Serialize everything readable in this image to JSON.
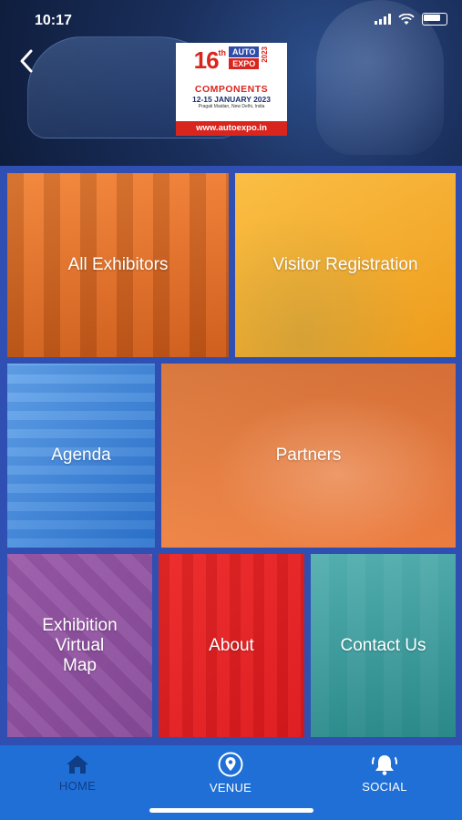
{
  "status_bar": {
    "time": "10:17"
  },
  "header": {
    "back_icon": "chevron-left-icon",
    "logo": {
      "edition_number": "16",
      "edition_suffix": "th",
      "brand_line1": "AUTO",
      "brand_line2": "EXPO",
      "year": "2023",
      "components": "COMPONENTS",
      "dates": "12-15 JANUARY 2023",
      "venue": "Pragati Maidan, New Delhi, India",
      "url": "www.autoexpo.in"
    }
  },
  "tiles": [
    {
      "label": "All Exhibitors"
    },
    {
      "label": "Visitor Registration"
    },
    {
      "label": "Agenda"
    },
    {
      "label": "Partners"
    },
    {
      "label": "Exhibition\nVirtual\nMap"
    },
    {
      "label": "About"
    },
    {
      "label": "Contact Us"
    }
  ],
  "bottom_nav": {
    "home": {
      "label": "HOME",
      "icon": "home-icon"
    },
    "venue": {
      "label": "VENUE",
      "icon": "location-pin-icon"
    },
    "social": {
      "label": "SOCIAL",
      "icon": "bell-icon"
    }
  },
  "colors": {
    "header_bg": "#1a2f5c",
    "grid_bg": "#2f4fb2",
    "nav_bg": "#1f6fd6",
    "nav_active": "#0f3e86",
    "brand_red": "#d8261f"
  }
}
